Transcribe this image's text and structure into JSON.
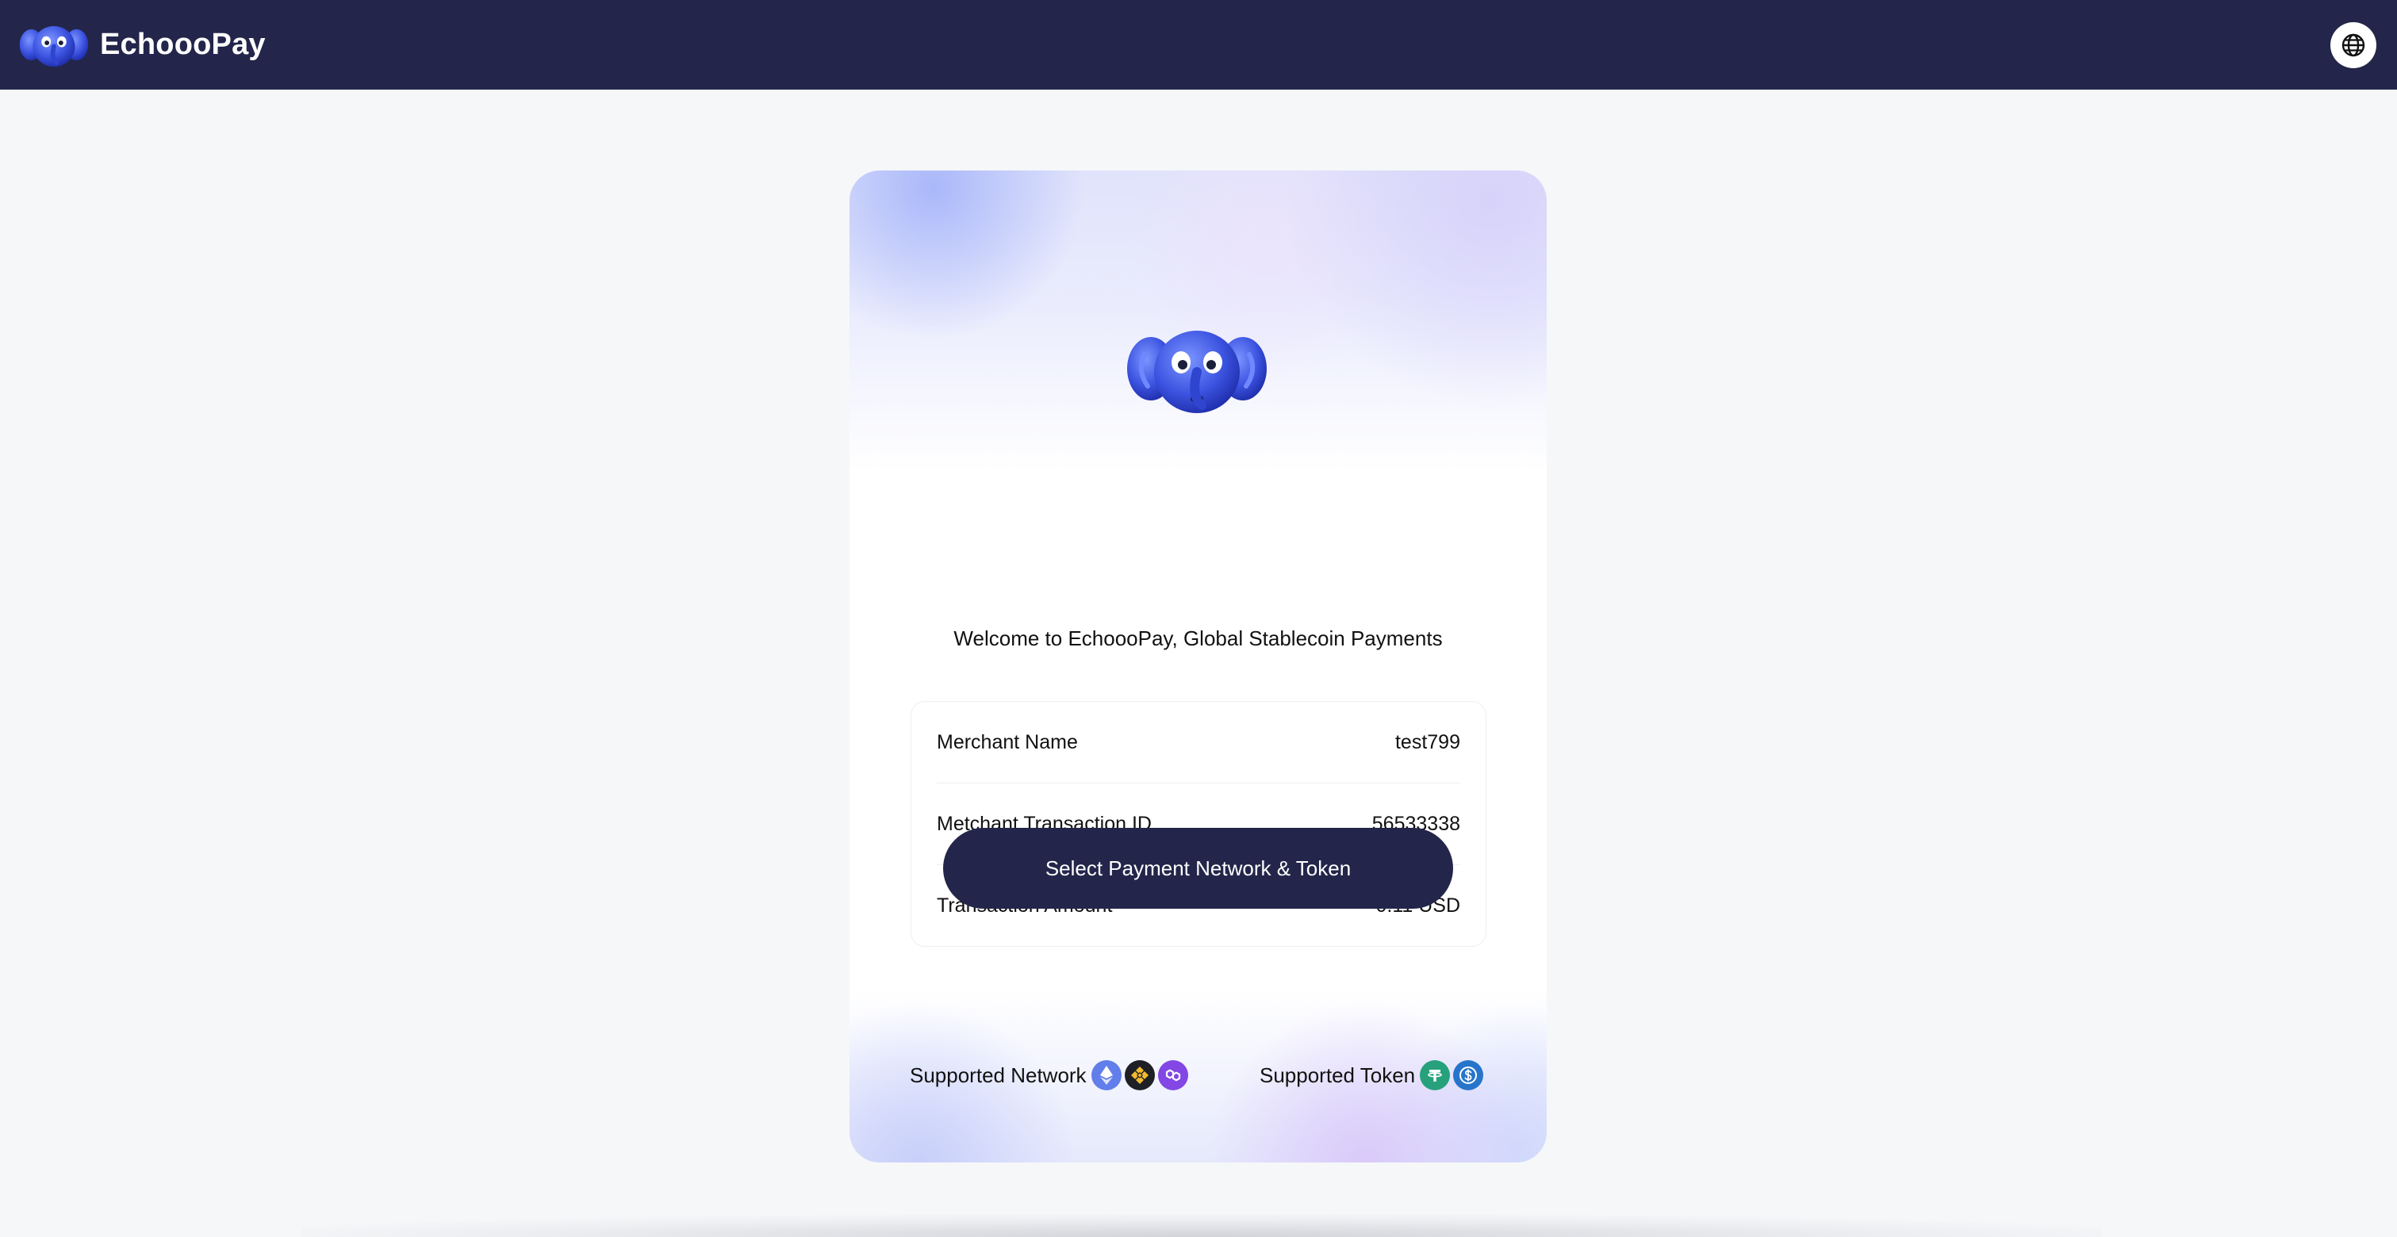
{
  "header": {
    "brand_name": "EchoooPay",
    "logo_icon": "elephant-mascot-icon",
    "language_icon": "globe-icon"
  },
  "card": {
    "welcome_text": "Welcome to EchoooPay, Global Stablecoin Payments",
    "details": [
      {
        "label": "Merchant Name",
        "value": "test799"
      },
      {
        "label": "Metchant Transaction ID",
        "value": "56533338"
      },
      {
        "label": "Transaction Amount",
        "value": "0.11 USD"
      }
    ],
    "cta_label": "Select Payment Network & Token",
    "supported_network_label": "Supported Network",
    "supported_networks": [
      "ethereum-icon",
      "bnb-chain-icon",
      "polygon-icon"
    ],
    "supported_token_label": "Supported Token",
    "supported_tokens": [
      "usdt-icon",
      "usdc-icon"
    ]
  },
  "colors": {
    "header_bg": "#23264a",
    "button_bg": "#23264a",
    "page_bg": "#f6f7f9",
    "ethereum": "#627eea",
    "bnb": "#f3ba2f",
    "polygon": "#8247e5",
    "usdt": "#26a17b",
    "usdc": "#2775ca"
  }
}
